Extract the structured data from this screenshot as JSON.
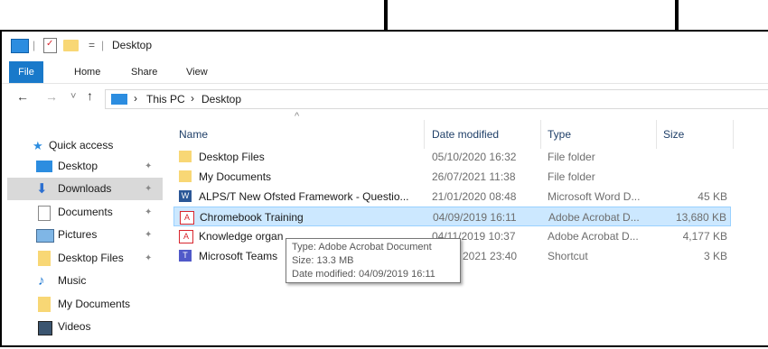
{
  "titlebar": {
    "title": "Desktop",
    "qat_sep": "|",
    "dropdown": "="
  },
  "ribbon": {
    "tabs": [
      "File",
      "Home",
      "Share",
      "View"
    ]
  },
  "nav": {
    "back": "←",
    "forward": "→",
    "recent": "˅",
    "up": "↑",
    "breadcrumb": [
      "This PC",
      "Desktop"
    ],
    "sep": "›"
  },
  "sidebar": {
    "quick_access": "Quick access",
    "items": [
      {
        "label": "Desktop",
        "icon": "desktop-icon",
        "pinned": true
      },
      {
        "label": "Downloads",
        "icon": "downloads-icon",
        "pinned": true,
        "selected": true
      },
      {
        "label": "Documents",
        "icon": "documents-icon",
        "pinned": true
      },
      {
        "label": "Pictures",
        "icon": "pictures-icon",
        "pinned": true
      },
      {
        "label": "Desktop Files",
        "icon": "folder-icon",
        "pinned": true
      },
      {
        "label": "Music",
        "icon": "music-icon",
        "pinned": false
      },
      {
        "label": "My Documents",
        "icon": "folder-icon",
        "pinned": false
      },
      {
        "label": "Videos",
        "icon": "videos-icon",
        "pinned": false
      }
    ],
    "pin_glyph": "✦"
  },
  "columns": {
    "name": "Name",
    "date": "Date modified",
    "type": "Type",
    "size": "Size",
    "sort_glyph": "^"
  },
  "files": [
    {
      "name": "Desktop Files",
      "date": "05/10/2020 16:32",
      "type": "File folder",
      "size": "",
      "icon": "folder-icon"
    },
    {
      "name": "My Documents",
      "date": "26/07/2021 11:38",
      "type": "File folder",
      "size": "",
      "icon": "folder-icon"
    },
    {
      "name": "ALPS/T New Ofsted Framework - Questio...",
      "date": "21/01/2020 08:48",
      "type": "Microsoft Word D...",
      "size": "45 KB",
      "icon": "word-icon"
    },
    {
      "name": "Chromebook Training",
      "date": "04/09/2019 16:11",
      "type": "Adobe Acrobat D...",
      "size": "13,680 KB",
      "icon": "pdf-icon",
      "selected": true
    },
    {
      "name": "Knowledge organ",
      "date": "04/11/2019 10:37",
      "type": "Adobe Acrobat D...",
      "size": "4,177 KB",
      "icon": "pdf-icon"
    },
    {
      "name": "Microsoft Teams",
      "date": "2021 23:40",
      "type": "Shortcut",
      "size": "3 KB",
      "icon": "teams-icon"
    }
  ],
  "tooltip": {
    "line1": "Type: Adobe Acrobat Document",
    "line2": "Size: 13.3 MB",
    "line3": "Date modified: 04/09/2019 16:11"
  },
  "colors": {
    "accent": "#1979ca",
    "selection": "#cce8ff",
    "folder": "#f8d775",
    "pdf": "#d8262e"
  }
}
